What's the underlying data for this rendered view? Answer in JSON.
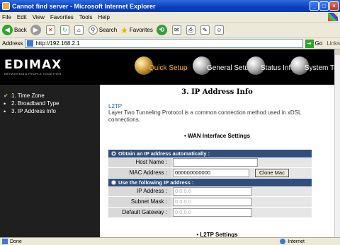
{
  "window": {
    "title": "Cannot find server - Microsoft Internet Explorer"
  },
  "menu": [
    "File",
    "Edit",
    "View",
    "Favorites",
    "Tools",
    "Help"
  ],
  "toolbar": {
    "back": "Back",
    "search": "Search",
    "favorites": "Favorites"
  },
  "address": {
    "label": "Address",
    "url": "http://192.168.2.1",
    "go": "Go",
    "links": "Links"
  },
  "brand": {
    "logo": "EDIMAX",
    "tagline": "NETWORKING PEOPLE TOGETHER"
  },
  "nav": [
    "Quick Setup",
    "General Setup",
    "Status Info",
    "System Tools"
  ],
  "sidebar": {
    "items": [
      {
        "mark": "✔",
        "label": "1. Time Zone"
      },
      {
        "mark": "•",
        "label": "2. Broadband Type"
      },
      {
        "mark": "•",
        "label": "3. IP Address Info"
      }
    ]
  },
  "main": {
    "title": "3. IP Address Info",
    "section": "L2TP",
    "description": "Layer Two Tunneling Protocol is a common connection method used in xDSL connections.",
    "wan_header": "WAN Interface Settings",
    "auto": {
      "label": "Obtain an IP address automatically :",
      "host_label": "Host Name :",
      "host_value": "",
      "mac_label": "MAC Address :",
      "mac_value": "000000000000",
      "clone_button": "Clone Mac"
    },
    "manual": {
      "label": "Use the following IP address :",
      "ip_label": "IP Address :",
      "ip_value": "0.0.0.0",
      "mask_label": "Subnet Mask :",
      "mask_value": "0.0.0.0",
      "gw_label": "Default Gateway :",
      "gw_value": "0.0.0.0"
    },
    "l2tp_header": "L2TP Settings"
  },
  "status": {
    "left": "Done",
    "zone": "Internet"
  }
}
